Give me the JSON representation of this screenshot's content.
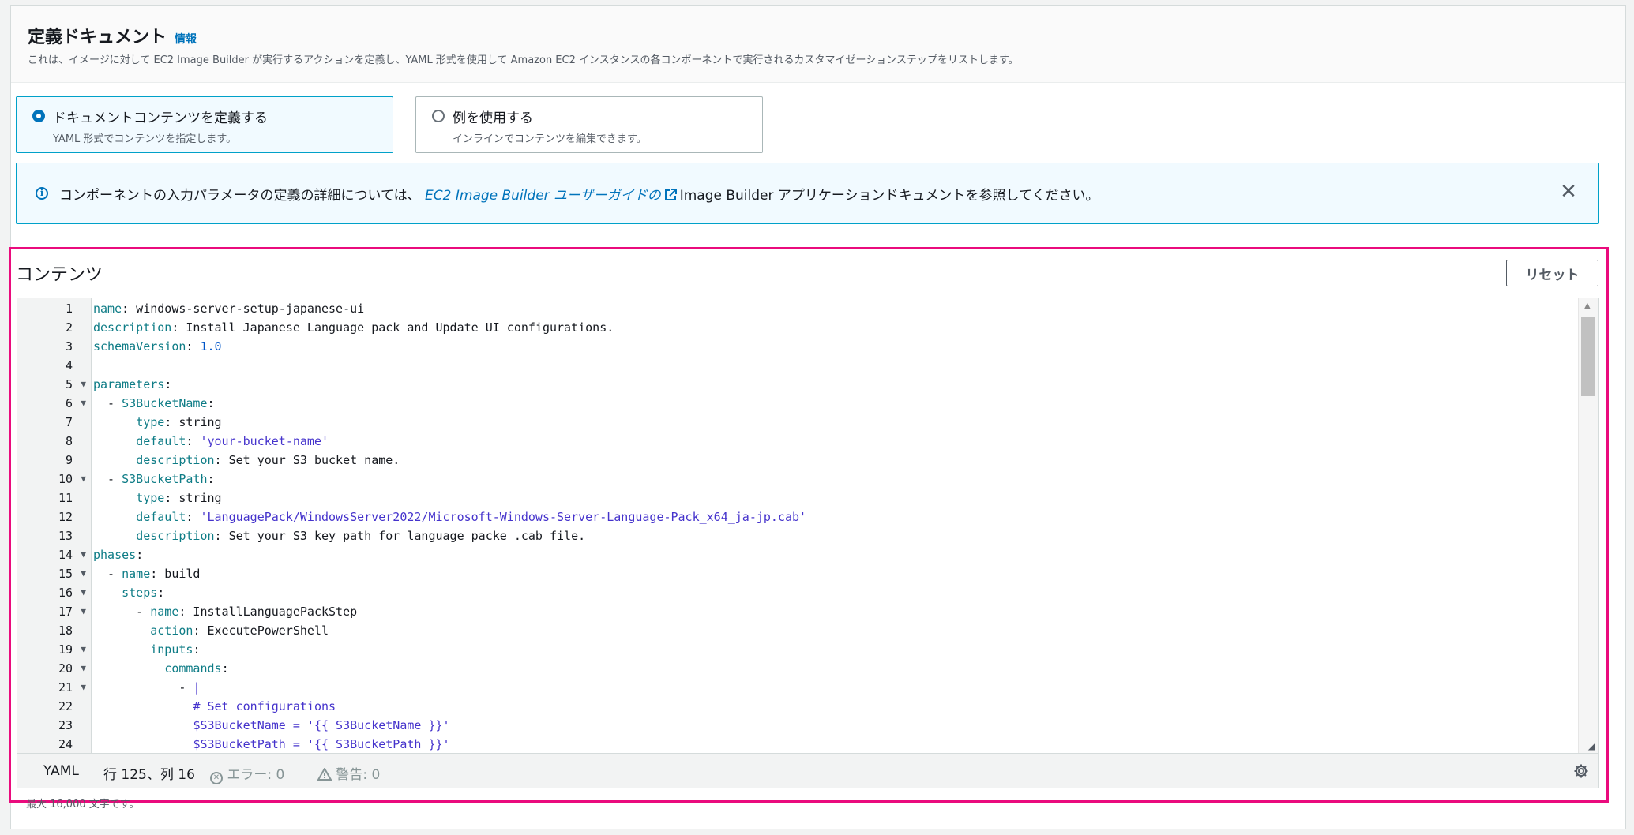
{
  "header": {
    "title": "定義ドキュメント",
    "info_link": "情報",
    "description": "これは、イメージに対して EC2 Image Builder が実行するアクションを定義し、YAML 形式を使用して Amazon EC2 インスタンスの各コンポーネントで実行されるカスタマイゼーションステップをリストします。"
  },
  "tiles": [
    {
      "label": "ドキュメントコンテンツを定義する",
      "description": "YAML 形式でコンテンツを指定します。",
      "selected": true
    },
    {
      "label": "例を使用する",
      "description": "インラインでコンテンツを編集できます。",
      "selected": false
    }
  ],
  "alert": {
    "prefix": "コンポーネントの入力パラメータの定義の詳細については、",
    "link": "EC2 Image Builder ユーザーガイドの",
    "suffix": "Image Builder アプリケーションドキュメントを参照してください。"
  },
  "content": {
    "title": "コンテンツ",
    "reset_label": "リセット"
  },
  "editor": {
    "lines": [
      {
        "num": "1",
        "fold": false
      },
      {
        "num": "2",
        "fold": false
      },
      {
        "num": "3",
        "fold": false
      },
      {
        "num": "4",
        "fold": false
      },
      {
        "num": "5",
        "fold": true
      },
      {
        "num": "6",
        "fold": true
      },
      {
        "num": "7",
        "fold": false
      },
      {
        "num": "8",
        "fold": false
      },
      {
        "num": "9",
        "fold": false
      },
      {
        "num": "10",
        "fold": true
      },
      {
        "num": "11",
        "fold": false
      },
      {
        "num": "12",
        "fold": false
      },
      {
        "num": "13",
        "fold": false
      },
      {
        "num": "14",
        "fold": true
      },
      {
        "num": "15",
        "fold": true
      },
      {
        "num": "16",
        "fold": true
      },
      {
        "num": "17",
        "fold": true
      },
      {
        "num": "18",
        "fold": false
      },
      {
        "num": "19",
        "fold": true
      },
      {
        "num": "20",
        "fold": true
      },
      {
        "num": "21",
        "fold": true
      },
      {
        "num": "22",
        "fold": false
      },
      {
        "num": "23",
        "fold": false
      },
      {
        "num": "24",
        "fold": false
      }
    ],
    "code": [
      [
        [
          "k",
          "name"
        ],
        [
          "p",
          ": windows-server-setup-japanese-ui"
        ]
      ],
      [
        [
          "k",
          "description"
        ],
        [
          "p",
          ": Install Japanese Language pack and Update UI configurations."
        ]
      ],
      [
        [
          "k",
          "schemaVersion"
        ],
        [
          "p",
          ": "
        ],
        [
          "n",
          "1.0"
        ]
      ],
      [],
      [
        [
          "k",
          "parameters"
        ],
        [
          "p",
          ":"
        ]
      ],
      [
        [
          "p",
          "  - "
        ],
        [
          "k",
          "S3BucketName"
        ],
        [
          "p",
          ":"
        ]
      ],
      [
        [
          "p",
          "      "
        ],
        [
          "k",
          "type"
        ],
        [
          "p",
          ": string"
        ]
      ],
      [
        [
          "p",
          "      "
        ],
        [
          "k",
          "default"
        ],
        [
          "p",
          ": "
        ],
        [
          "s",
          "'your-bucket-name'"
        ]
      ],
      [
        [
          "p",
          "      "
        ],
        [
          "k",
          "description"
        ],
        [
          "p",
          ": Set your S3 bucket name."
        ]
      ],
      [
        [
          "p",
          "  - "
        ],
        [
          "k",
          "S3BucketPath"
        ],
        [
          "p",
          ":"
        ]
      ],
      [
        [
          "p",
          "      "
        ],
        [
          "k",
          "type"
        ],
        [
          "p",
          ": string"
        ]
      ],
      [
        [
          "p",
          "      "
        ],
        [
          "k",
          "default"
        ],
        [
          "p",
          ": "
        ],
        [
          "s",
          "'LanguagePack/WindowsServer2022/Microsoft-Windows-Server-Language-Pack_x64_ja-jp.cab'"
        ]
      ],
      [
        [
          "p",
          "      "
        ],
        [
          "k",
          "description"
        ],
        [
          "p",
          ": Set your S3 key path for language packe .cab file."
        ]
      ],
      [
        [
          "k",
          "phases"
        ],
        [
          "p",
          ":"
        ]
      ],
      [
        [
          "p",
          "  - "
        ],
        [
          "k",
          "name"
        ],
        [
          "p",
          ": build"
        ]
      ],
      [
        [
          "p",
          "    "
        ],
        [
          "k",
          "steps"
        ],
        [
          "p",
          ":"
        ]
      ],
      [
        [
          "p",
          "      - "
        ],
        [
          "k",
          "name"
        ],
        [
          "p",
          ": InstallLanguagePackStep"
        ]
      ],
      [
        [
          "p",
          "        "
        ],
        [
          "k",
          "action"
        ],
        [
          "p",
          ": ExecutePowerShell"
        ]
      ],
      [
        [
          "p",
          "        "
        ],
        [
          "k",
          "inputs"
        ],
        [
          "p",
          ":"
        ]
      ],
      [
        [
          "p",
          "          "
        ],
        [
          "k",
          "commands"
        ],
        [
          "p",
          ":"
        ]
      ],
      [
        [
          "p",
          "            - "
        ],
        [
          "s",
          "|"
        ]
      ],
      [
        [
          "p",
          "              "
        ],
        [
          "s",
          "# Set configurations"
        ]
      ],
      [
        [
          "p",
          "              "
        ],
        [
          "s",
          "$S3BucketName = '{{ S3BucketName }}'"
        ]
      ],
      [
        [
          "p",
          "              "
        ],
        [
          "s",
          "$S3BucketPath = '{{ S3BucketPath }}'"
        ]
      ]
    ]
  },
  "status": {
    "language": "YAML",
    "position": "行 125、列 16",
    "errors": "エラー: 0",
    "warnings": "警告: 0"
  },
  "footer_note": "最大 16,000 文字です。",
  "colors": {
    "accent": "#0073bb",
    "highlight_border": "#ea0b7d",
    "key": "#0e7c86",
    "string": "#4533cc"
  }
}
